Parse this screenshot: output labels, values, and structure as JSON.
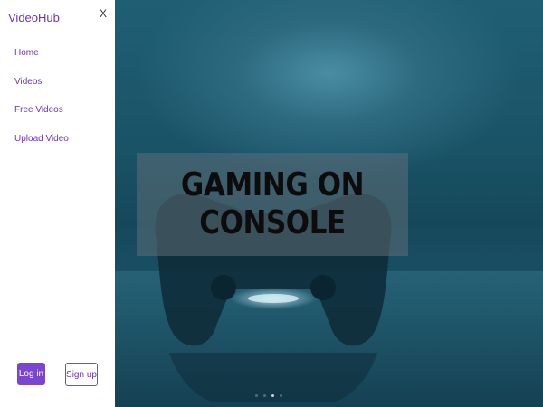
{
  "drawer": {
    "brand": "VideoHub",
    "close_label": "X",
    "nav_items": [
      {
        "label": "Home"
      },
      {
        "label": "Videos"
      },
      {
        "label": "Free Videos"
      },
      {
        "label": "Upload Video"
      }
    ],
    "login_label": "Log in",
    "signup_label": "Sign up"
  },
  "carousel": {
    "caption": "GAMING ON CONSOLE",
    "slide_count": 4,
    "active_slide": 3,
    "image": "game-controller-photo"
  },
  "colors": {
    "accent": "#7a46d0",
    "brand_text": "#6a35c2",
    "hero_bg": "#1a5367"
  }
}
